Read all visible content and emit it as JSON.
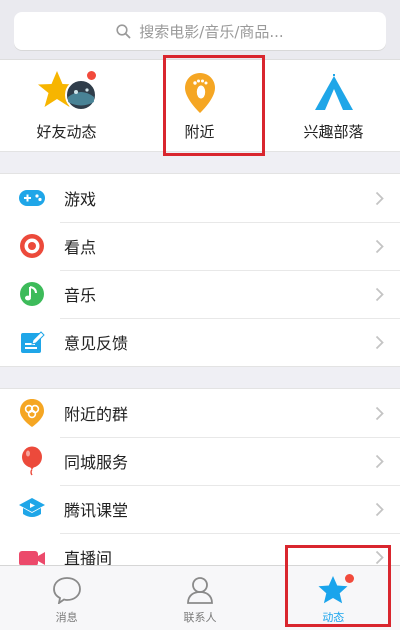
{
  "search": {
    "placeholder": "搜索电影/音乐/商品..."
  },
  "quick_entries": [
    {
      "label": "好友动态",
      "icon": "friend-feed-icon",
      "badge": true
    },
    {
      "label": "附近",
      "icon": "nearby-footprint-icon",
      "badge": false
    },
    {
      "label": "兴趣部落",
      "icon": "tent-icon",
      "badge": false
    }
  ],
  "group1": [
    {
      "label": "游戏",
      "icon": "gamepad-icon"
    },
    {
      "label": "看点",
      "icon": "watch-point-icon"
    },
    {
      "label": "音乐",
      "icon": "music-note-icon"
    },
    {
      "label": "意见反馈",
      "icon": "feedback-edit-icon"
    }
  ],
  "group2": [
    {
      "label": "附近的群",
      "icon": "nearby-group-icon"
    },
    {
      "label": "同城服务",
      "icon": "balloon-icon"
    },
    {
      "label": "腾讯课堂",
      "icon": "classroom-icon"
    },
    {
      "label": "直播间",
      "icon": "live-camera-icon"
    }
  ],
  "tabs": [
    {
      "label": "消息",
      "icon": "chat-bubble-icon",
      "active": false
    },
    {
      "label": "联系人",
      "icon": "contacts-person-icon",
      "active": false
    },
    {
      "label": "动态",
      "icon": "star-icon",
      "active": true,
      "badge": true
    }
  ],
  "colors": {
    "accent": "#1aa4ec",
    "highlight": "#d9262e",
    "badge": "#f24a3c"
  }
}
